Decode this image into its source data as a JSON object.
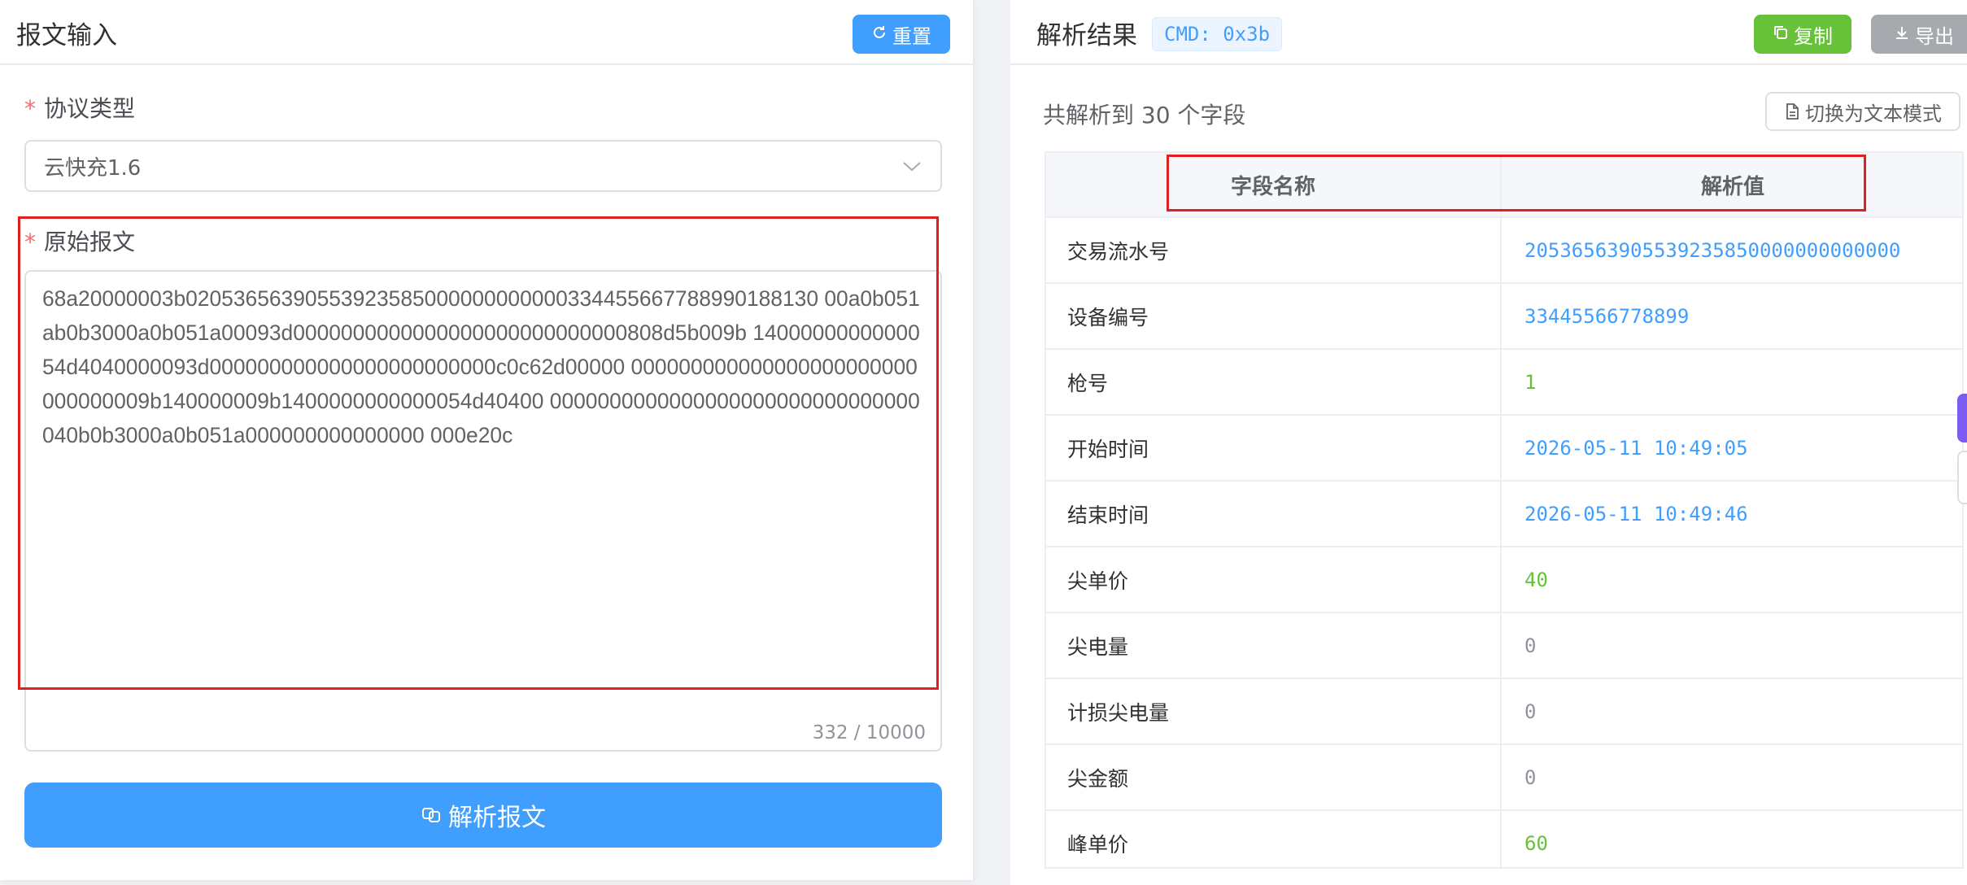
{
  "left": {
    "title": "报文输入",
    "reset_label": "重置",
    "protocol": {
      "required_mark": "*",
      "label": "协议类型",
      "selected": "云快充1.6"
    },
    "message": {
      "required_mark": "*",
      "label": "原始报文",
      "value": "68a20000003b02053656390553923585000000000000334455667788990188130 00a0b051ab0b3000a0b051a00093d0000000000000000000000000000808d5b009b 1400000000000054d4040000093d000000000000000000000000c0c62d00000 000000000000000000000000000000009b140000009b1400000000000054d40400 0000000000000000000000000000000040b0b3000a0b051a000000000000000 000e20c",
      "counter": "332 / 10000"
    },
    "parse_label": "解析报文"
  },
  "right": {
    "title": "解析结果",
    "cmd_tag": "CMD: 0x3b",
    "copy_label": "复制",
    "export_label": "导出",
    "summary": "共解析到 30 个字段",
    "switch_label": "切换为文本模式",
    "table": {
      "headers": [
        "字段名称",
        "解析值"
      ],
      "rows": [
        {
          "name": "交易流水号",
          "value": "20536563905539235850000000000000",
          "color": "#409eff"
        },
        {
          "name": "设备编号",
          "value": "33445566778899",
          "color": "#409eff"
        },
        {
          "name": "枪号",
          "value": "1",
          "color": "#67c23a"
        },
        {
          "name": "开始时间",
          "value": "2026-05-11 10:49:05",
          "color": "#409eff"
        },
        {
          "name": "结束时间",
          "value": "2026-05-11 10:49:46",
          "color": "#409eff"
        },
        {
          "name": "尖单价",
          "value": "40",
          "color": "#67c23a"
        },
        {
          "name": "尖电量",
          "value": "0",
          "color": "#909399"
        },
        {
          "name": "计损尖电量",
          "value": "0",
          "color": "#909399"
        },
        {
          "name": "尖金额",
          "value": "0",
          "color": "#909399"
        },
        {
          "name": "峰单价",
          "value": "60",
          "color": "#67c23a"
        }
      ]
    }
  }
}
